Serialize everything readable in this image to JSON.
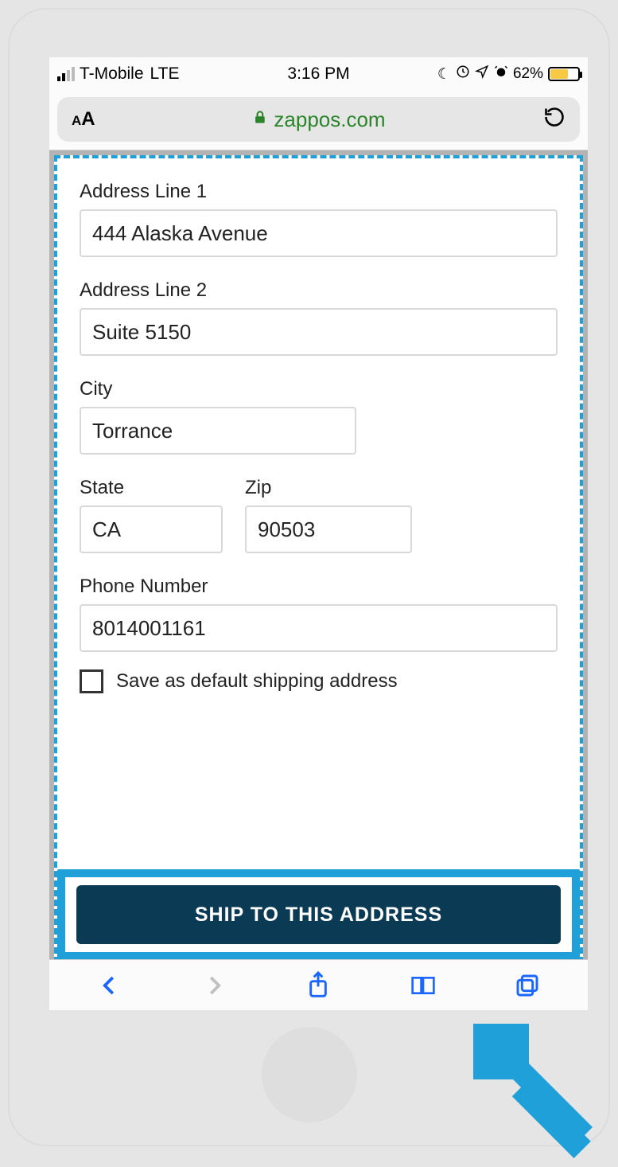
{
  "statusbar": {
    "carrier": "T-Mobile",
    "network": "LTE",
    "time": "3:16 PM",
    "battery_pct": "62%"
  },
  "browser": {
    "url_display": "zappos.com"
  },
  "form": {
    "addr1_label": "Address Line 1",
    "addr1_value": "444 Alaska Avenue",
    "addr2_label": "Address Line 2",
    "addr2_value": "Suite 5150",
    "city_label": "City",
    "city_value": "Torrance",
    "state_label": "State",
    "state_value": "CA",
    "zip_label": "Zip",
    "zip_value": "90503",
    "phone_label": "Phone Number",
    "phone_value": "8014001161",
    "save_default_label": "Save as default shipping address",
    "submit_label": "SHIP TO THIS ADDRESS"
  }
}
